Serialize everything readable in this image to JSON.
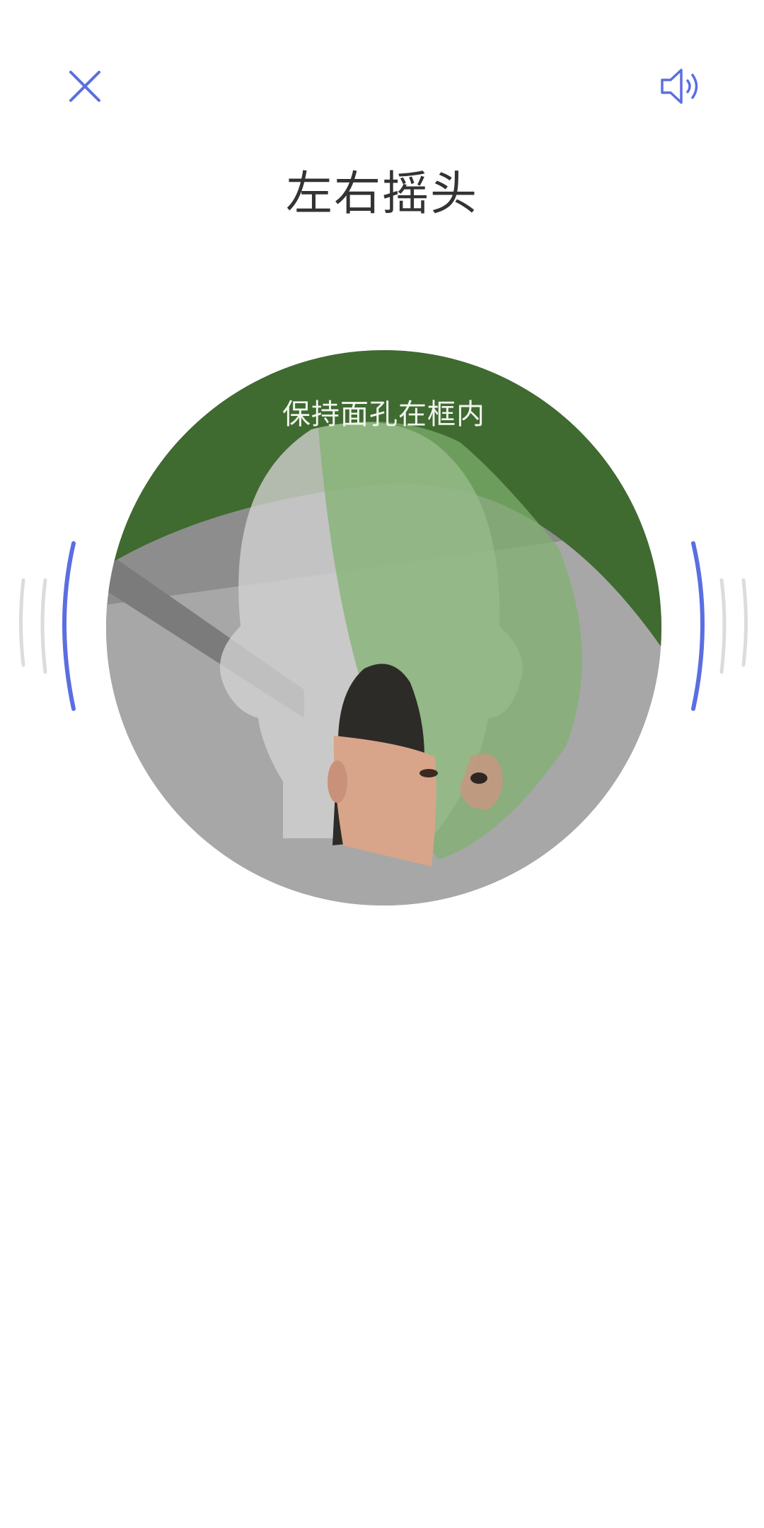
{
  "header": {
    "title": "左右摇头",
    "close_icon": "close-icon",
    "sound_icon": "speaker-icon"
  },
  "camera": {
    "hint": "保持面孔在框内"
  },
  "colors": {
    "accent": "#5b6ee1",
    "title": "#333333",
    "wave_inactive": "#dcdcdc",
    "overlay_green": "#7fb26f"
  }
}
